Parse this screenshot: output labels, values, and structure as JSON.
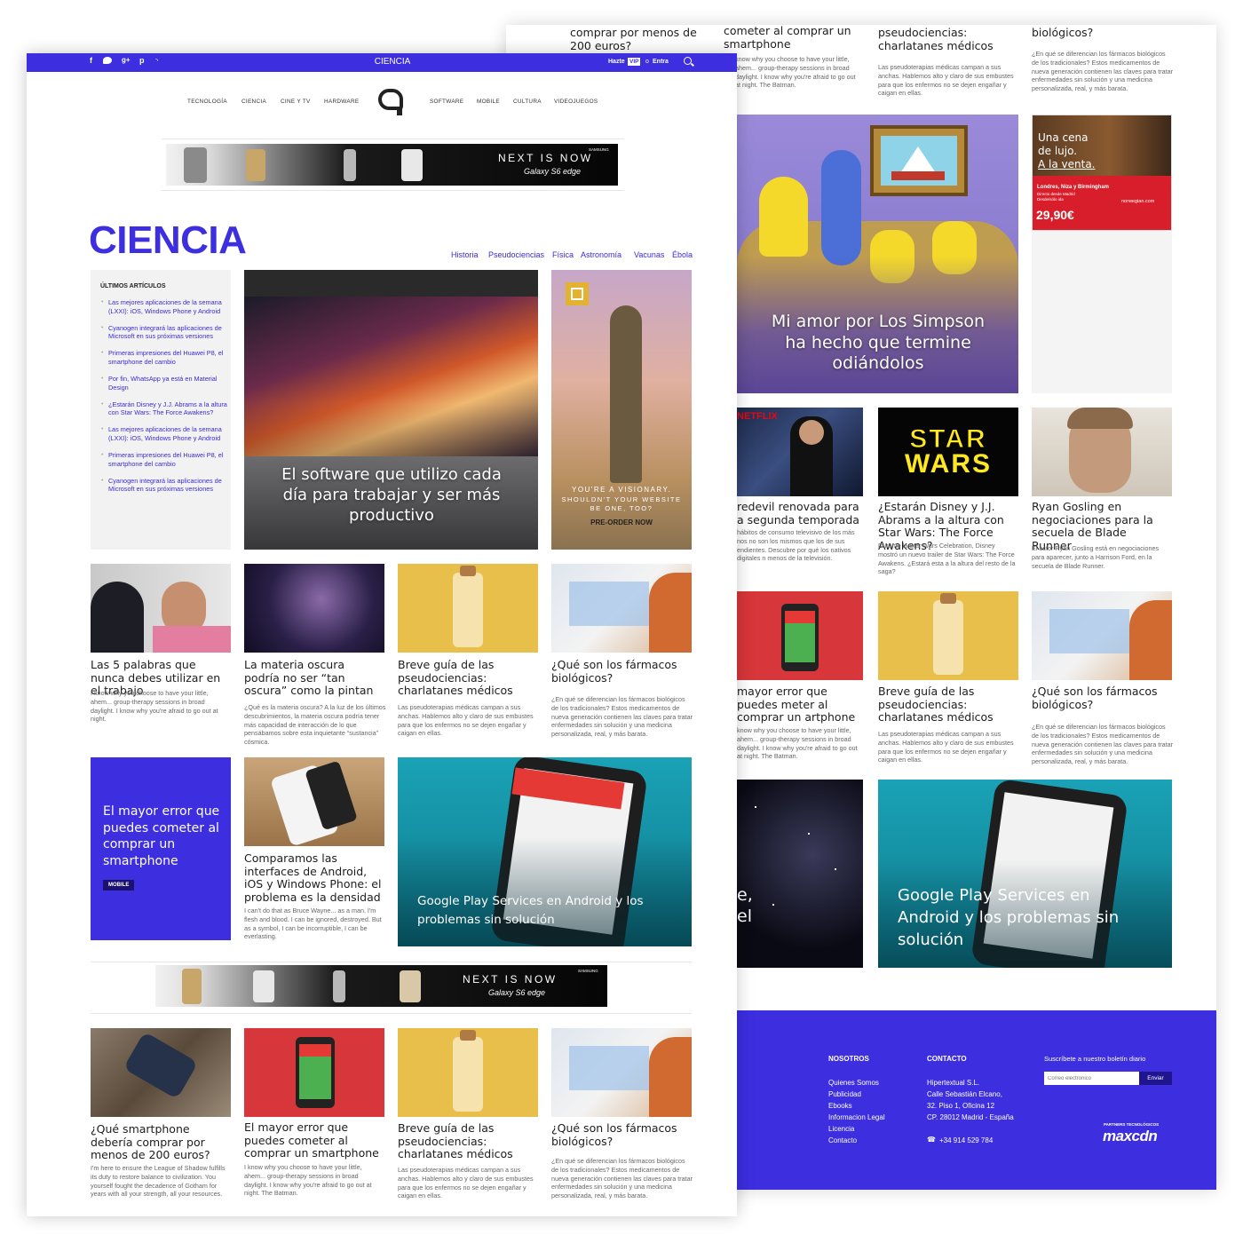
{
  "colors": {
    "brand": "#3d2ee0",
    "white": "#ffffff"
  },
  "topbar": {
    "section": "CIENCIA",
    "hazte": "Hazte",
    "vip": "VIP",
    "o": "o",
    "entra": "Entra",
    "social_icons": [
      "facebook-icon",
      "twitter-icon",
      "google-plus-icon",
      "pinterest-icon",
      "rss-icon"
    ]
  },
  "nav": {
    "left": [
      "TECNOLOGÍA",
      "CIENCIA",
      "CINE Y TV",
      "HARDWARE"
    ],
    "right": [
      "SOFTWARE",
      "MOBILE",
      "CULTURA",
      "VIDEOJUEGOS"
    ]
  },
  "ad_banner": {
    "line1": "NEXT IS NOW",
    "line2": "Galaxy S6 edge",
    "brand_small": "SAMSUNG",
    "brand_tiny": "SAMSUNG"
  },
  "page": {
    "title": "CIENCIA",
    "tags": [
      "Historia",
      "Pseudociencias",
      "Física",
      "Astronomía",
      "Vacunas",
      "Ébola"
    ]
  },
  "sidebar": {
    "heading": "ÚLTIMOS ARTÍCULOS",
    "items": [
      "Las mejores aplicaciones de la semana (LXXI): iOS, Windows Phone y Android",
      "Cyanogen integrará las aplicaciones de Microsoft en sus próximas versiones",
      "Primeras impresiones del Huawei P8, el smartphone del cambio",
      "Por fin, WhatsApp ya está en Material Design",
      "¿Estarán Disney y J.J. Abrams a la altura con Star Wars: The Force Awakens?",
      "Las mejores aplicaciones de la semana (LXXI): iOS, Windows Phone y Android",
      "Primeras impresiones del Huawei P8, el smartphone del cambio",
      "Cyanogen integrará las aplicaciones de Microsoft en sus próximas versiones"
    ]
  },
  "feature": {
    "title": "El software que utilizo cada día para trabajar y ser más productivo"
  },
  "side_ad": {
    "line1": "YOU'RE A VISIONARY.",
    "line2": "SHOULDN'T YOUR WEBSITE BE ONE, TOO?",
    "cta": "PRE-ORDER NOW"
  },
  "row1": [
    {
      "title": "Las 5 palabras que nunca debes utilizar en el trabajo",
      "excerpt": "I know why you choose to have your little, ahem... group-therapy sessions in broad daylight. I know why you're afraid to go out at night."
    },
    {
      "title": "La materia oscura podría no ser “tan oscura” como la pintan",
      "excerpt": "¿Qué es la materia oscura? A la luz de los últimos descubrimientos, la materia oscura podría tener más capacidad de interacción de lo que pensábamos sobre esta inquietante “sustancia” cósmica."
    },
    {
      "title": "Breve guía de las pseudociencias: charlatanes médicos",
      "excerpt": "Las pseudoterapias médicas campan a sus anchas. Hablemos alto y claro de sus embustes para que los enfermos no se dejen engañar y caigan en ellas."
    },
    {
      "title": "¿Qué son los fármacos biológicos?",
      "excerpt": "¿En qué se diferencian los fármacos biológicos de los tradicionales? Estos medicamentos de nueva generación contienen las claves para tratar enfermedades sin solución y una medicina personalizada, real, y más barata."
    }
  ],
  "promo": {
    "title": "El mayor error que puedes cometer al comprar un smartphone",
    "badge": "MOBILE"
  },
  "compare": {
    "title": "Comparamos las interfaces de Android, iOS y Windows Phone: el problema es la densidad",
    "excerpt": "I can't do that as Bruce Wayne... as a man. I'm flesh and blood. I can be ignored, destroyed. But as a symbol, I can be incorruptible, I can be everlasting."
  },
  "gplay": {
    "title": "Google Play Services en Android y los problemas sin solución"
  },
  "row3": [
    {
      "title": "¿Qué smartphone debería comprar por menos de 200 euros?",
      "excerpt": "I'm here to ensure the League of Shadow fulfills its duty to restore balance to civilization. You yourself fought the decadence of Gotham for years with all your strength, all your resources."
    },
    {
      "title": "El mayor error que puedes cometer al comprar un smartphone",
      "excerpt": "I know why you choose to have your little, ahem... group-therapy sessions in broad daylight. I know why you're afraid to go out at night. The Batman."
    },
    {
      "title": "Breve guía de las pseudociencias: charlatanes médicos",
      "excerpt": "Las pseudoterapias médicas campan a sus anchas. Hablemos alto y claro de sus embustes para que los enfermos no se dejen engañar y caigan en ellas."
    },
    {
      "title": "¿Qué son los fármacos biológicos?",
      "excerpt": "¿En qué se diferencian los fármacos biológicos de los tradicionales? Estos medicamentos de nueva generación contienen las claves para tratar enfermedades sin solución y una medicina personalizada, real, y más barata."
    }
  ],
  "back": {
    "top": [
      {
        "title": "comprar por menos de 200 euros?"
      },
      {
        "title": "cometer al comprar un smartphone",
        "excerpt": "know why you choose to have your little, ahem... group-therapy sessions in broad daylight. I know why you're afraid to go out at night. The Batman."
      },
      {
        "title": "pseudociencias: charlatanes médicos",
        "excerpt": "Las pseudoterapias médicas campan a sus anchas. Hablemos alto y claro de sus embustes para que los enfermos no se dejen engañar y caigan en ellas."
      },
      {
        "title": "biológicos?",
        "excerpt": "¿En qué se diferencian los fármacos biológicos de los tradicionales? Estos medicamentos de nueva generación contienen las claves para tratar enfermedades sin solución y una medicina personalizada, real, y más barata."
      }
    ],
    "simpsons": {
      "title": "Mi amor por Los Simpson ha hecho que termine odiándolos"
    },
    "norwegian": {
      "l1": "Una cena",
      "l2": "de lujo.",
      "l3": "A la venta.",
      "dest": "Londres, Niza y Birmingham",
      "sub": "Directo desde Madrid",
      "sub2": "Desde/sólo ida",
      "price": "29,90€",
      "brand": "norwegian.com",
      "netflix": "NETFLIX",
      "starwars1": "STAR",
      "starwars2": "WARS"
    },
    "row2": [
      {
        "title": "redevil renovada para a segunda temporada",
        "excerpt": "hábitos de consumo televisivo de los más nos no son los mismos que los de sus endientes. Descubre por qué los nativos digitales n menos de la televisión."
      },
      {
        "title": "¿Estarán Disney y J.J. Abrams a la altura con Star Wars: The Force Awakens?",
        "excerpt": "Durante la Star Wars Celebration, Disney mostró un nuevo trailer de Star Wars: The Force Awakens. ¿Estará esta a la altura del resto de la saga?"
      },
      {
        "title": "Ryan Gosling en negociaciones para la secuela de Blade Runner",
        "excerpt": "El actor Ryan Gosling está en negociaciones para aparecer, junto a Harrison Ford, en la secuela de Blade Runner."
      }
    ],
    "row3": [
      {
        "title": "mayor error que puedes meter al comprar un artphone",
        "excerpt": "know why you choose to have your little, ahem... group-therapy sessions in broad daylight. I know why you're afraid to go out at night. The Batman."
      },
      {
        "title": "Breve guía de las pseudociencias: charlatanes médicos",
        "excerpt": "Las pseudoterapias médicas campan a sus anchas. Hablemos alto y claro de sus embustes para que los enfermos no se dejen engañar y caigan en ellas."
      },
      {
        "title": "¿Qué son los fármacos biológicos?",
        "excerpt": "¿En qué se diferencian los fármacos biológicos de los tradicionales? Estos medicamentos de nueva generación contienen las claves para tratar enfermedades sin solución y una medicina personalizada, real, y más barata."
      }
    ],
    "space_partial": {
      "l1": "e,",
      "l2": "el"
    },
    "gplay": {
      "title": "Google Play Services en Android y los problemas sin solución"
    }
  },
  "footer": {
    "nosotros": {
      "heading": "NOSOTROS",
      "links": [
        "Quienes Somos",
        "Publicidad",
        "Ebooks",
        "Informacion Legal",
        "Licencia",
        "Contacto"
      ]
    },
    "contacto": {
      "heading": "CONTACTO",
      "lines": [
        "Hipertextual S.L.",
        "Calle Sebastián Elcano,",
        "32. Piso 1, Oficina 12",
        "CP. 28012 Madrid - España"
      ],
      "phone": "+34 914 529 784"
    },
    "newsletter": {
      "heading": "Suscríbete a nuestro boletín diario",
      "placeholder": "Correo electrónico",
      "button": "Enviar"
    },
    "partners": {
      "label": "PARTNERS TECNOLÓGICOS",
      "logo": "maxcdn"
    }
  }
}
